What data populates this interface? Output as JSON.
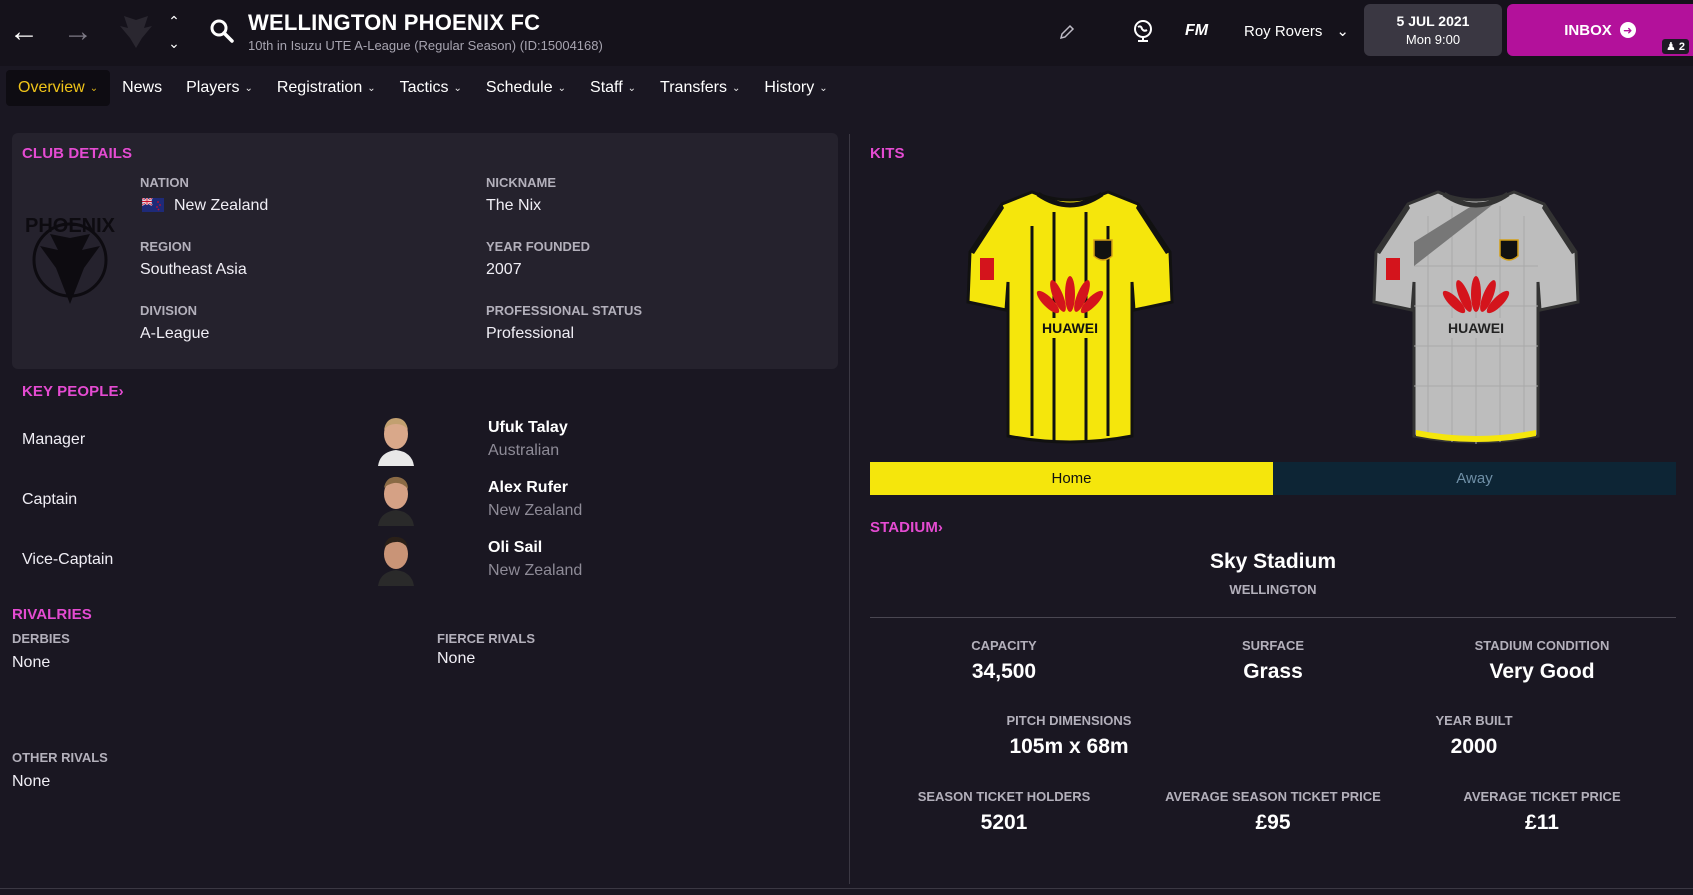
{
  "header": {
    "club_name": "WELLINGTON PHOENIX FC",
    "subtitle": "10th in Isuzu UTE A-League (Regular Season) (ID:15004168)",
    "fm_label": "FM",
    "manager": "Roy Rovers",
    "date": "5 JUL 2021",
    "time": "Mon 9:00",
    "inbox_label": "INBOX",
    "inbox_count": "2"
  },
  "tabs": [
    {
      "label": "Overview",
      "active": true
    },
    {
      "label": "News",
      "active": false
    },
    {
      "label": "Players",
      "active": false
    },
    {
      "label": "Registration",
      "active": false
    },
    {
      "label": "Tactics",
      "active": false
    },
    {
      "label": "Schedule",
      "active": false
    },
    {
      "label": "Staff",
      "active": false
    },
    {
      "label": "Transfers",
      "active": false
    },
    {
      "label": "History",
      "active": false
    }
  ],
  "club_details": {
    "title": "CLUB DETAILS",
    "nation_label": "NATION",
    "nation": "New Zealand",
    "region_label": "REGION",
    "region": "Southeast Asia",
    "division_label": "DIVISION",
    "division": "A-League",
    "nickname_label": "NICKNAME",
    "nickname": "The Nix",
    "founded_label": "YEAR FOUNDED",
    "founded": "2007",
    "status_label": "PROFESSIONAL STATUS",
    "status": "Professional",
    "badge_text": "PHOENIX"
  },
  "key_people": {
    "title": "KEY PEOPLE",
    "people": [
      {
        "role": "Manager",
        "name": "Ufuk Talay",
        "nationality": "Australian"
      },
      {
        "role": "Captain",
        "name": "Alex Rufer",
        "nationality": "New Zealand"
      },
      {
        "role": "Vice-Captain",
        "name": "Oli Sail",
        "nationality": "New Zealand"
      }
    ]
  },
  "rivalries": {
    "title": "RIVALRIES",
    "derbies_label": "DERBIES",
    "derbies": "None",
    "fierce_label": "FIERCE RIVALS",
    "fierce": "None",
    "other_label": "OTHER RIVALS",
    "other": "None"
  },
  "kits": {
    "title": "KITS",
    "sponsor": "HUAWEI",
    "home_label": "Home",
    "away_label": "Away",
    "colors": {
      "home": "#f5e60c",
      "away": "#bdbdbd",
      "accent": "#e54bd2"
    }
  },
  "stadium": {
    "title": "STADIUM",
    "name": "Sky Stadium",
    "city": "WELLINGTON",
    "stats": [
      {
        "label": "CAPACITY",
        "value": "34,500"
      },
      {
        "label": "SURFACE",
        "value": "Grass"
      },
      {
        "label": "STADIUM CONDITION",
        "value": "Very Good"
      },
      {
        "label": "PITCH DIMENSIONS",
        "value": "105m x 68m"
      },
      {
        "label": "YEAR BUILT",
        "value": "2000"
      },
      {
        "label": "SEASON TICKET HOLDERS",
        "value": "5201"
      },
      {
        "label": "AVERAGE SEASON TICKET PRICE",
        "value": "£95"
      },
      {
        "label": "AVERAGE TICKET PRICE",
        "value": "£11"
      }
    ]
  }
}
